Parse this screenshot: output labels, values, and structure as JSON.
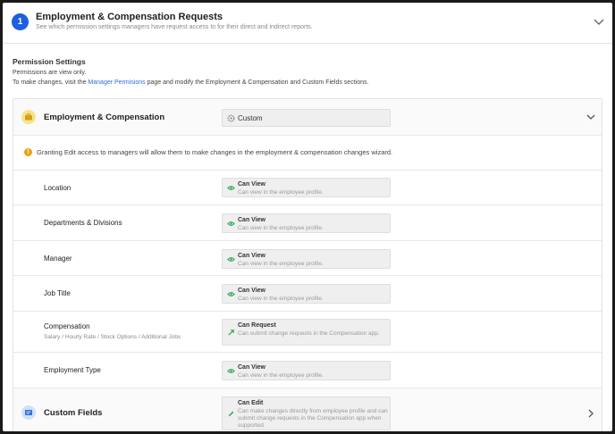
{
  "step": {
    "number": "1",
    "title": "Employment & Compensation Requests",
    "subtitle": "See which permission settings managers have request access to for their direct and indirect reports."
  },
  "permission_settings": {
    "title": "Permission Settings",
    "line1": "Permissions are view only.",
    "line2_prefix": "To make changes, visit the ",
    "line2_link": "Manager Permisions",
    "line2_suffix": " page and modify the Employment & Compensation and Custom Fields sections."
  },
  "employment_section": {
    "label": "Employment & Compensation",
    "select_value": "Custom",
    "warning": "Granting Edit access to managers will allow them to make changes in the employment & compensation changes wizard.",
    "fields": [
      {
        "label": "Location",
        "sub": "",
        "perm": "Can View",
        "desc": "Can view in the employee profile."
      },
      {
        "label": "Departments & Divisions",
        "sub": "",
        "perm": "Can View",
        "desc": "Can view in the employee profile."
      },
      {
        "label": "Manager",
        "sub": "",
        "perm": "Can View",
        "desc": "Can view in the employee profile."
      },
      {
        "label": "Job Title",
        "sub": "",
        "perm": "Can View",
        "desc": "Can view in the employee profile."
      },
      {
        "label": "Compensation",
        "sub": "Salary / Hourly Rate / Stock Options / Additional Jobs",
        "perm": "Can Request",
        "desc": "Can submit change requests in the Compensation app."
      },
      {
        "label": "Employment Type",
        "sub": "",
        "perm": "Can View",
        "desc": "Can view in the employee profile."
      }
    ]
  },
  "custom_fields_section": {
    "label": "Custom Fields",
    "perm": "Can Edit",
    "desc": "Can make changes directly from employee profile and can submit change requests in the Compensation app when supported."
  },
  "colors": {
    "accent": "#1c5fe0",
    "link": "#2d6fd6",
    "view_icon": "#2fa85a",
    "warning": "#e8a317",
    "employment_icon_bg": "#f7e38a",
    "custom_icon_bg": "#cfe0fb"
  }
}
